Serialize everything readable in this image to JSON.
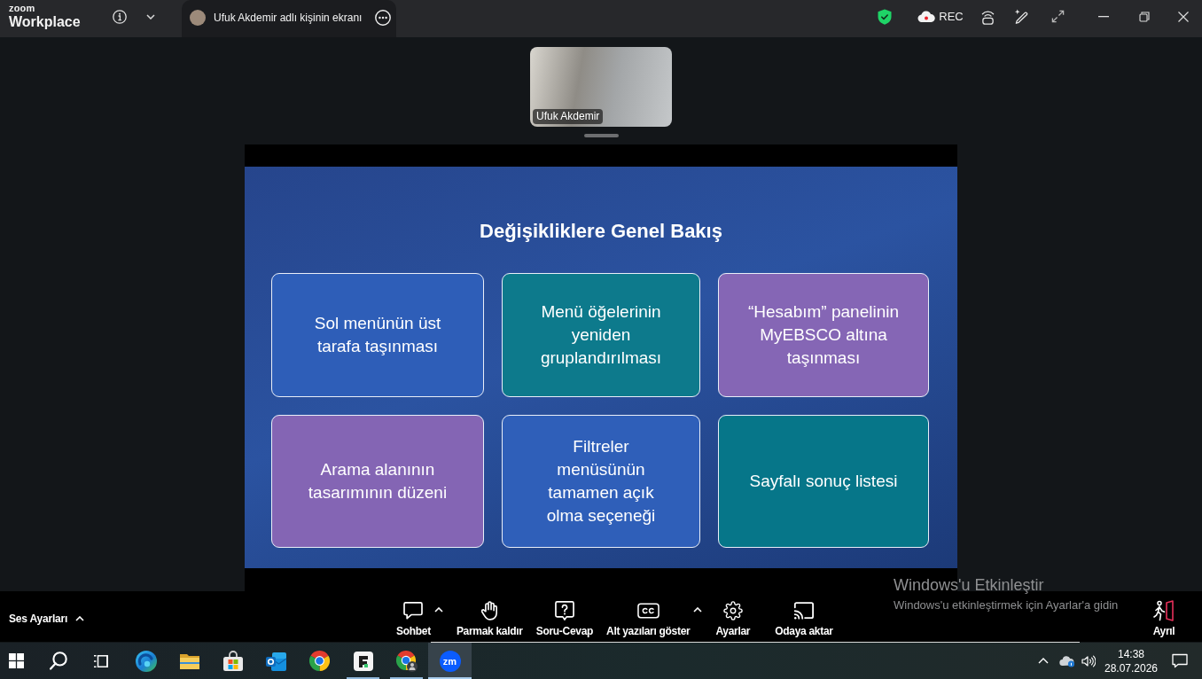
{
  "title_bar": {
    "logo": {
      "top": "zoom",
      "bottom": "Workplace"
    },
    "tab": {
      "title": "Ufuk Akdemir adlı kişinin ekranı"
    },
    "record": {
      "label": "REC"
    }
  },
  "video_tile": {
    "name": "Ufuk Akdemir"
  },
  "slide": {
    "title": "Değişikliklere Genel Bakış",
    "cards": [
      {
        "lines": [
          "Sol menünün üst",
          "tarafa taşınması"
        ],
        "color": "#2e5eb8"
      },
      {
        "lines": [
          "Menü öğelerinin",
          "yeniden",
          "gruplandırılması"
        ],
        "color": "#0d7a8c"
      },
      {
        "lines": [
          "“Hesabım” panelinin",
          "MyEBSCO altına",
          "taşınması"
        ],
        "color": "#8566b5"
      },
      {
        "lines": [
          "Arama alanının",
          "tasarımının düzeni"
        ],
        "color": "#8465b4"
      },
      {
        "lines": [
          "Filtreler",
          "menüsünün",
          "tamamen açık",
          "olma seçeneği"
        ],
        "color": "#2f5fb9"
      },
      {
        "lines": [
          "Sayfalı sonuç listesi"
        ],
        "color": "#067689"
      }
    ]
  },
  "meeting_controls": {
    "audio_settings": {
      "label": "Ses Ayarları"
    },
    "items": [
      {
        "kind": "chat",
        "label": "Sohbet",
        "caret": true
      },
      {
        "kind": "raise_hand",
        "label": "Parmak kaldır",
        "caret": false
      },
      {
        "kind": "qa",
        "label": "Soru-Cevap",
        "caret": false
      },
      {
        "kind": "captions",
        "label": "Alt yazıları göster",
        "caret": true
      },
      {
        "kind": "settings",
        "label": "Ayarlar",
        "caret": false
      },
      {
        "kind": "cast",
        "label": "Odaya aktar",
        "caret": false
      }
    ],
    "leave": {
      "label": "Ayrıl"
    }
  },
  "activation_notice": {
    "title": "Windows'u Etkinleştir",
    "message": "Windows'u etkinleştirmek için Ayarlar'a gidin"
  },
  "taskbar": {
    "buttons": [
      {
        "kind": "start"
      },
      {
        "kind": "search"
      },
      {
        "kind": "task_view"
      }
    ],
    "apps": [
      {
        "kind": "edge",
        "open": false,
        "selected": false
      },
      {
        "kind": "file_explorer",
        "open": false,
        "selected": false
      },
      {
        "kind": "store",
        "open": false,
        "selected": false
      },
      {
        "kind": "outlook",
        "open": false,
        "selected": false
      },
      {
        "kind": "chrome",
        "open": false,
        "selected": false
      },
      {
        "kind": "tile_app",
        "open": true,
        "selected": false
      },
      {
        "kind": "chrome_profile",
        "open": true,
        "selected": false
      },
      {
        "kind": "zoom",
        "label": "zm",
        "open": true,
        "selected": true
      }
    ],
    "clock": {
      "time": "14:38",
      "date": "28.07.2026"
    }
  }
}
